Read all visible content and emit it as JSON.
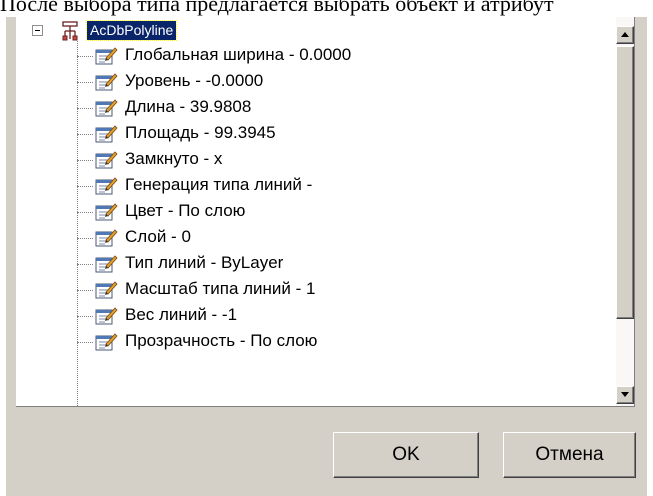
{
  "caption": "После выбора типа предлагается выбрать объект и атрибут",
  "colors": {
    "dialog_bg": "#d4d0c8",
    "selection_bg": "#0a246a",
    "selection_text": "#ffffff"
  },
  "tree": {
    "root": {
      "label": "AcDbPolyline",
      "icon": "class-structure-icon",
      "expanded": true,
      "selected": true
    },
    "items": [
      {
        "label": "Глобальная ширина - 0.0000",
        "icon": "property-edit-icon"
      },
      {
        "label": "Уровень - -0.0000",
        "icon": "property-edit-icon"
      },
      {
        "label": "Длина - 39.9808",
        "icon": "property-edit-icon"
      },
      {
        "label": "Площадь - 99.3945",
        "icon": "property-edit-icon"
      },
      {
        "label": "Замкнуто - x",
        "icon": "property-edit-icon"
      },
      {
        "label": "Генерация типа линий -",
        "icon": "property-edit-icon"
      },
      {
        "label": "Цвет - По слою",
        "icon": "property-edit-icon"
      },
      {
        "label": "Слой - 0",
        "icon": "property-edit-icon"
      },
      {
        "label": "Тип линий - ByLayer",
        "icon": "property-edit-icon"
      },
      {
        "label": "Масштаб типа линий - 1",
        "icon": "property-edit-icon"
      },
      {
        "label": "Вес линий - -1",
        "icon": "property-edit-icon"
      },
      {
        "label": "Прозрачность - По слою",
        "icon": "property-edit-icon"
      }
    ]
  },
  "buttons": {
    "ok": "OK",
    "cancel": "Отмена"
  }
}
